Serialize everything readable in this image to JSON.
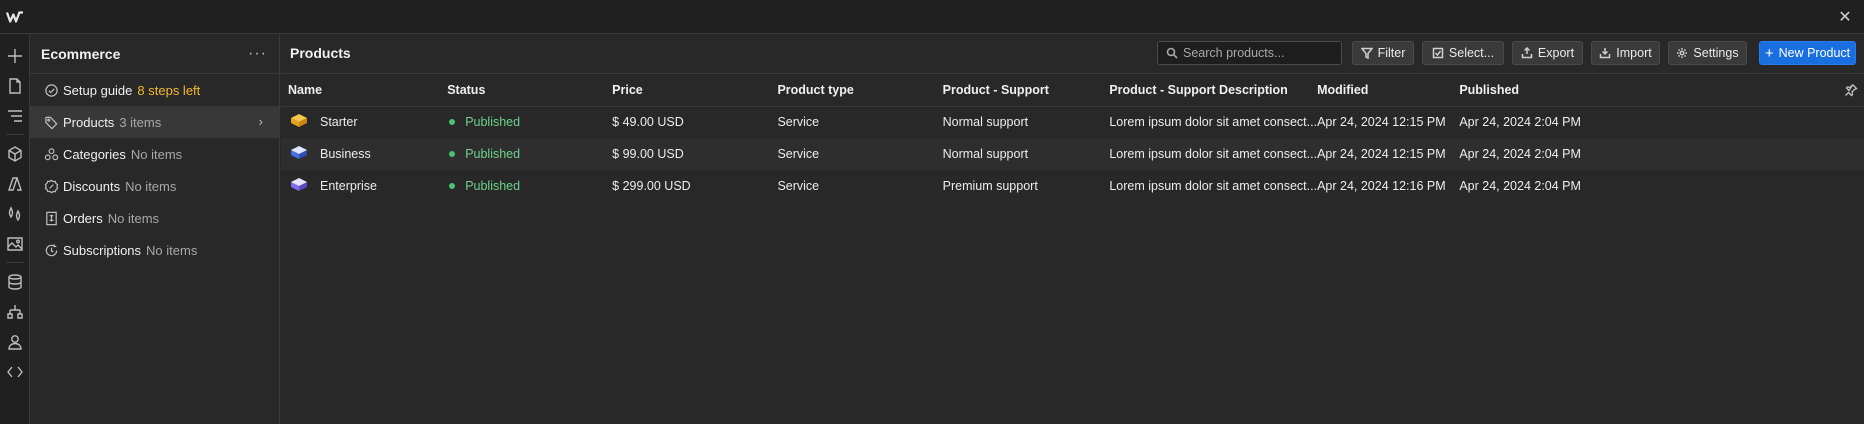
{
  "topbar": {
    "close_symbol": "✕"
  },
  "rail": {
    "icons": [
      "add-icon",
      "page-icon",
      "navigator-icon",
      "components-icon",
      "style-selector-icon",
      "variables-icon",
      "assets-icon",
      "cms-icon",
      "logic-icon",
      "users-icon",
      "code-icon"
    ]
  },
  "sidebar": {
    "title": "Ecommerce",
    "more_symbol": "···",
    "items": [
      {
        "label": "Setup guide",
        "count": "8 steps left",
        "icon": "check-circle-icon"
      },
      {
        "label": "Products",
        "count": "3 items",
        "icon": "tag-icon"
      },
      {
        "label": "Categories",
        "count": "No items",
        "icon": "categories-icon"
      },
      {
        "label": "Discounts",
        "count": "No items",
        "icon": "discount-icon"
      },
      {
        "label": "Orders",
        "count": "No items",
        "icon": "orders-icon"
      },
      {
        "label": "Subscriptions",
        "count": "No items",
        "icon": "subscriptions-icon"
      }
    ],
    "chevron": "›"
  },
  "main": {
    "title": "Products",
    "search_placeholder": "Search products...",
    "buttons": {
      "filter": "Filter",
      "select": "Select...",
      "export": "Export",
      "import": "Import",
      "settings": "Settings",
      "new_product": "New Product",
      "new_product_symbol": "+"
    },
    "columns": [
      "Name",
      "Status",
      "Price",
      "Product type",
      "Product - Support",
      "Product - Support Description",
      "Modified",
      "Published"
    ],
    "rows": [
      {
        "name": "Starter",
        "status": "Published",
        "price": "$ 49.00 USD",
        "type": "Service",
        "support": "Normal support",
        "desc": "Lorem ipsum dolor sit amet consect...",
        "modified": "Apr 24, 2024 12:15 PM",
        "published": "Apr 24, 2024 2:04 PM"
      },
      {
        "name": "Business",
        "status": "Published",
        "price": "$ 99.00 USD",
        "type": "Service",
        "support": "Normal support",
        "desc": "Lorem ipsum dolor sit amet consect...",
        "modified": "Apr 24, 2024 12:15 PM",
        "published": "Apr 24, 2024 2:04 PM"
      },
      {
        "name": "Enterprise",
        "status": "Published",
        "price": "$ 299.00 USD",
        "type": "Service",
        "support": "Premium support",
        "desc": "Lorem ipsum dolor sit amet consect...",
        "modified": "Apr 24, 2024 12:16 PM",
        "published": "Apr 24, 2024 2:04 PM"
      }
    ]
  },
  "colors": {
    "accent": "#1a6fe0",
    "published": "#6fd08c",
    "setup_warning": "#f5b82e",
    "starter_icon": "#f0a81e",
    "business_icon": "#4a6fe0",
    "enterprise_icon": "#7f6fe8"
  }
}
